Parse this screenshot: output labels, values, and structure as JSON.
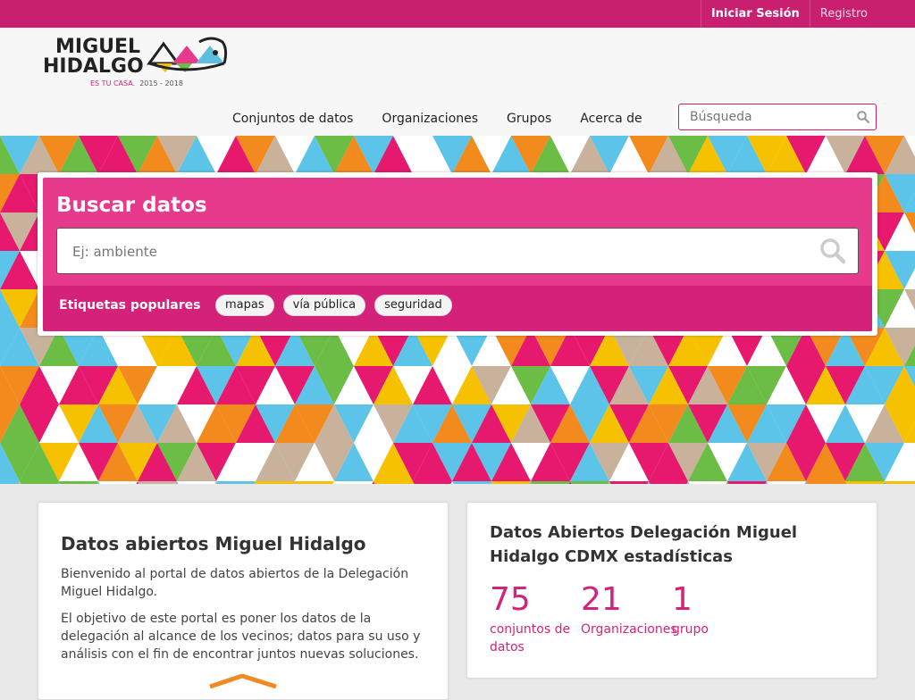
{
  "topbar": {
    "login": "Iniciar Sesión",
    "register": "Registro"
  },
  "logo": {
    "line1": "MIGUEL",
    "line2": "HIDALGO",
    "tagline_a": "ES TU CASA.",
    "tagline_b": "2015 - 2018"
  },
  "nav": {
    "datasets": "Conjuntos de datos",
    "organizations": "Organizaciones",
    "groups": "Grupos",
    "about": "Acerca de"
  },
  "header_search": {
    "placeholder": "Búsqueda"
  },
  "hero": {
    "title": "Buscar datos",
    "search_placeholder": "Ej: ambiente",
    "tags_label": "Etiquetas populares",
    "tags": [
      "mapas",
      "vía pública",
      "seguridad"
    ]
  },
  "intro": {
    "title": "Datos abiertos Miguel Hidalgo",
    "p1": "Bienvenido al portal de datos abiertos de la Delegación Miguel Hidalgo.",
    "p2": "El objetivo de este portal es poner los datos de la delegación al alcance de los vecinos; datos para su uso y análisis con el fin de encontrar juntos nuevas soluciones."
  },
  "stats": {
    "title": "Datos Abiertos Delegación Miguel Hidalgo CDMX estadísticas",
    "items": [
      {
        "number": "75",
        "label": "conjuntos de datos"
      },
      {
        "number": "21",
        "label": "Organizaciones"
      },
      {
        "number": "1",
        "label": "grupo"
      }
    ]
  },
  "colors": {
    "brand_pink": "#c8206e",
    "accent_pink": "#e73a8c",
    "tags_bar": "#d4217a"
  }
}
